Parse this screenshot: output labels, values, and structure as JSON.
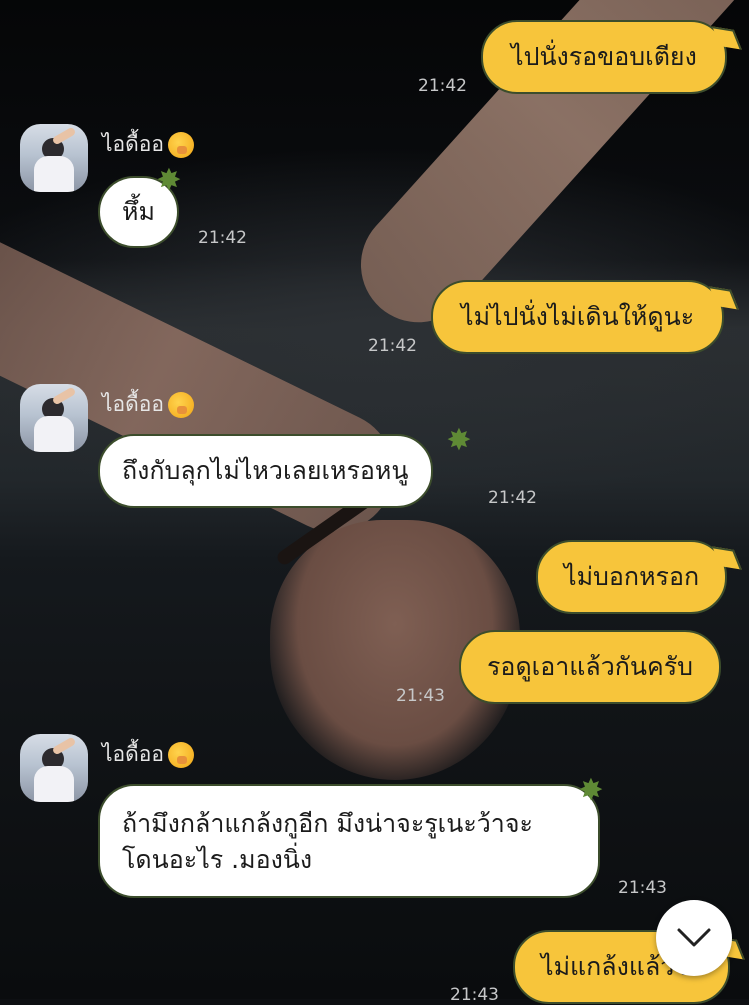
{
  "messages": [
    {
      "text": "ไปนั่งรอขอบเตียง",
      "time": "21:42"
    },
    {
      "sender": "ไอดื้ออ",
      "text": "หึ้ม",
      "time": "21:42"
    },
    {
      "text": "ไม่ไปนั่งไม่เดินให้ดูนะ",
      "time": "21:42"
    },
    {
      "sender": "ไอดื้ออ",
      "text": "ถึงกับลุกไม่ไหวเลยเหรอหนู",
      "time": "21:42"
    },
    {
      "text": "ไม่บอกหรอก"
    },
    {
      "text": "รอดูเอาแล้วกันครับ",
      "time": "21:43"
    },
    {
      "sender": "ไอดื้ออ",
      "text_line1": "ถ้ามึงกล้าแกล้งกูอีก มึงน่าจะรูเนะว้าจะ",
      "text_line2": "โดนอะไร .มองนิ่ง",
      "time": "21:43"
    },
    {
      "text": "ไม่แกล้งแล้ววว",
      "time": "21:43"
    }
  ],
  "icons": {
    "scroll_down": "chevron-down-icon",
    "reaction": "shushing-face-emoji"
  },
  "colors": {
    "outgoing_bubble": "#f7c53b",
    "incoming_bubble": "#ffffff",
    "bubble_border": "#3c4d2c",
    "sticker_star": "#5f8a35"
  }
}
